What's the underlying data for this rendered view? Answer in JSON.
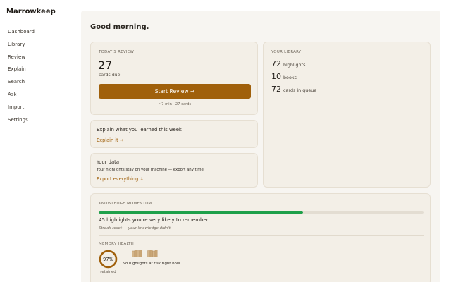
{
  "app": {
    "title": "Marrowkeep"
  },
  "nav": {
    "items": [
      {
        "label": "Dashboard"
      },
      {
        "label": "Library"
      },
      {
        "label": "Review"
      },
      {
        "label": "Explain"
      },
      {
        "label": "Search"
      },
      {
        "label": "Ask"
      },
      {
        "label": "Import"
      },
      {
        "label": "Settings"
      }
    ]
  },
  "greeting": "Good morning.",
  "review": {
    "label": "TODAY'S REVIEW",
    "count": "27",
    "sub": "cards due",
    "button": "Start Review →",
    "meta": "~7 min · 27 cards"
  },
  "library": {
    "label": "YOUR LIBRARY",
    "stats": [
      {
        "value": "72",
        "text": "highlights"
      },
      {
        "value": "10",
        "text": "books"
      },
      {
        "value": "72",
        "text": "cards in queue"
      }
    ]
  },
  "explain": {
    "title": "Explain what you learned this week",
    "link": "Explain it →"
  },
  "data_card": {
    "title": "Your data",
    "desc": "Your highlights stay on your machine — export any time.",
    "link": "Export everything ↓"
  },
  "momentum": {
    "label": "KNOWLEDGE MOMENTUM",
    "progress_fraction": 0.63,
    "highlights_text": "45 highlights you're very likely to remember",
    "streak_text": "Streak reset — your knowledge didn't."
  },
  "memory": {
    "label": "MEMORY HEALTH",
    "retained_pct": 97,
    "retained_text": "97%",
    "retained_label": "retained",
    "risk_text": "No highlights at risk right now."
  },
  "colors": {
    "accent": "#a0600b",
    "progress": "#1ea04a",
    "card_bg": "#f3efe7"
  },
  "icons": [
    "book-stack-icon",
    "book-stack-icon"
  ]
}
